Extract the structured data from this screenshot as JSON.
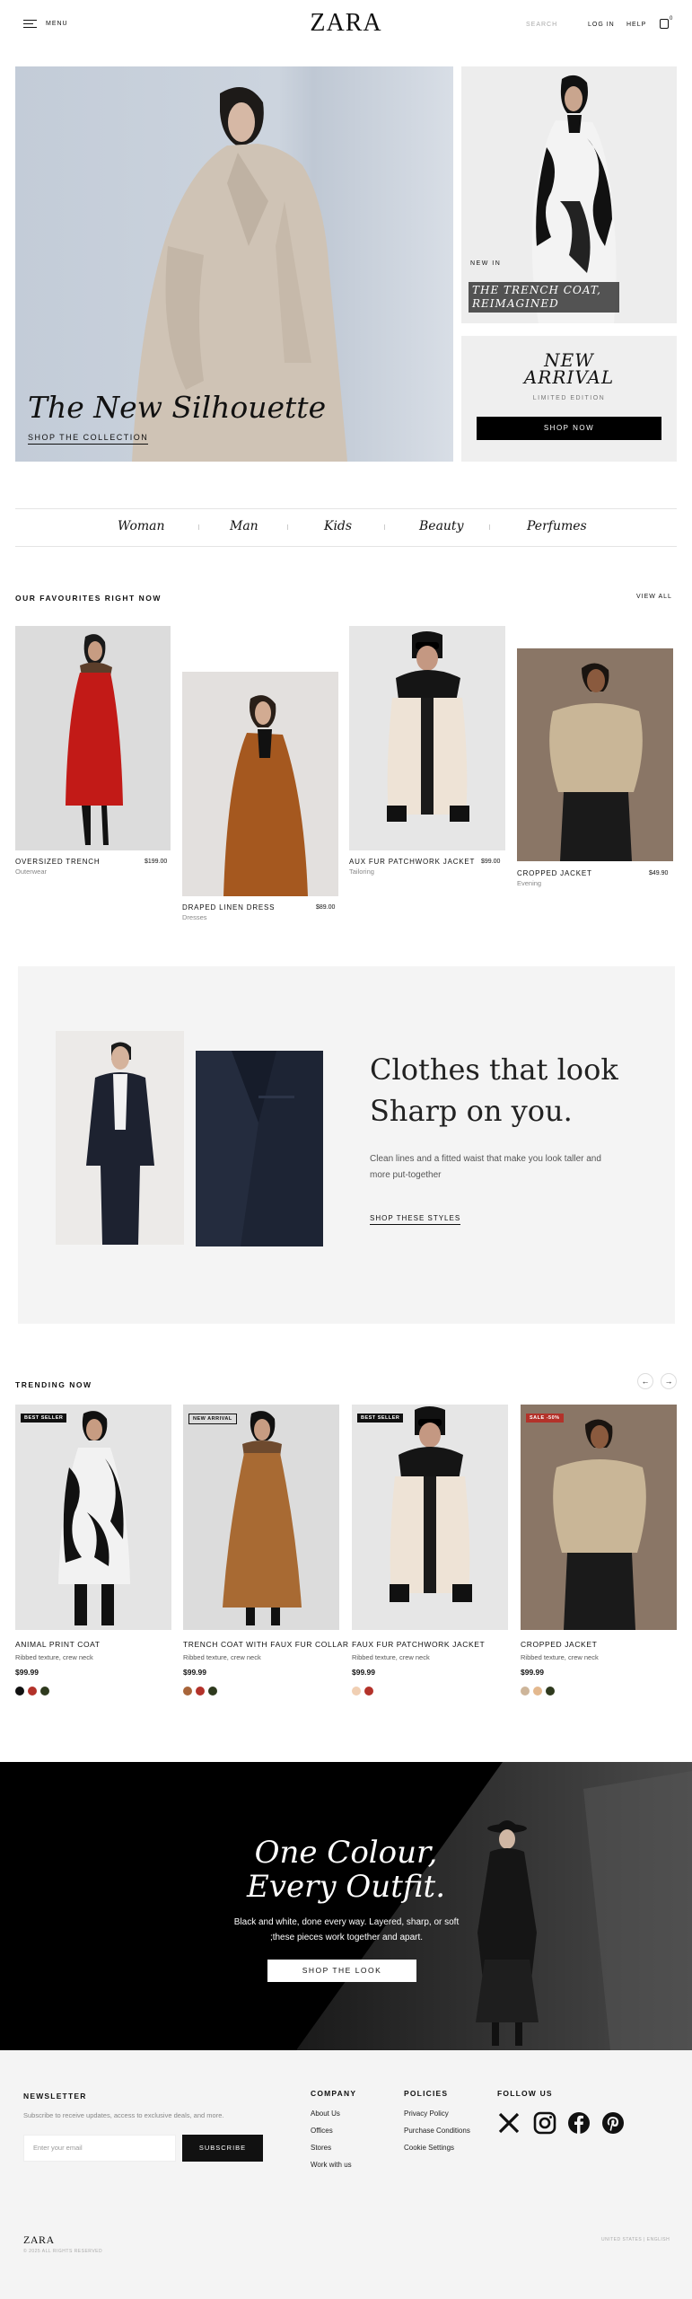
{
  "header": {
    "menu_label": "MENU",
    "logo": "ZARA",
    "search_placeholder": "SEARCH",
    "login_label": "LOG IN",
    "help_label": "HELP",
    "bag_count": "0"
  },
  "hero": {
    "title": "The New Silhouette",
    "cta": "SHOP THE COLLECTION",
    "side_tag": "NEW IN",
    "side_title_line1": "THE TRENCH COAT,",
    "side_title_line2": "REIMAGINED",
    "arrival_line1": "NEW",
    "arrival_line2": "ARRIVAL",
    "arrival_sub": "LIMITED EDITION",
    "arrival_btn": "SHOP NOW"
  },
  "categories": [
    "Woman",
    "Man",
    "Kids",
    "Beauty",
    "Perfumes"
  ],
  "favourites": {
    "title": "OUR FAVOURITES RIGHT NOW",
    "view_all": "VIEW ALL",
    "items": [
      {
        "name": "OVERSIZED TRENCH",
        "category": "Outerwear",
        "price": "$199.00"
      },
      {
        "name": "DRAPED LINEN DRESS",
        "category": "Dresses",
        "price": "$89.00"
      },
      {
        "name": "AUX FUR PATCHWORK JACKET",
        "category": "Tailoring",
        "price": "$99.00"
      },
      {
        "name": "CROPPED JACKET",
        "category": "Evening",
        "price": "$49.90"
      }
    ]
  },
  "sharp": {
    "title_line1": "Clothes that look",
    "title_line2": "Sharp on you.",
    "description": "Clean lines and a fitted waist that make you look taller and more put-together",
    "cta": "SHOP THESE STYLES"
  },
  "trending": {
    "title": "TRENDING NOW",
    "prev_icon": "←",
    "next_icon": "→",
    "items": [
      {
        "badge": "BEST SELLER",
        "name": "ANIMAL PRINT COAT",
        "desc": "Ribbed texture, crew neck",
        "price": "$99.99",
        "swatches": [
          "#111111",
          "#b3322a",
          "#2f3a1e"
        ]
      },
      {
        "badge": "NEW ARRIVAL",
        "name": "TRENCH COAT WITH FAUX FUR COLLAR",
        "desc": "Ribbed texture, crew neck",
        "price": "$99.99",
        "swatches": [
          "#a8653a",
          "#b3322a",
          "#2f3a1e"
        ]
      },
      {
        "badge": "BEST SELLER",
        "name": "FAUX FUR PATCHWORK JACKET",
        "desc": "Ribbed texture, crew neck",
        "price": "$99.99",
        "swatches": [
          "#f0cfb3",
          "#b3322a"
        ]
      },
      {
        "badge": "SALE -50%",
        "name": "CROPPED JACKET",
        "desc": "Ribbed texture, crew neck",
        "price": "$99.99",
        "swatches": [
          "#cdb59a",
          "#e3b88e",
          "#2f3a1e"
        ]
      }
    ]
  },
  "banner": {
    "title_line1": "One Colour,",
    "title_line2": "Every Outfit.",
    "description": "Black and white, done every way. Layered, sharp, or soft ;these pieces work together and apart.",
    "cta": "SHOP THE LOOK"
  },
  "footer": {
    "newsletter_title": "NEWSLETTER",
    "newsletter_sub": "Subscribe to receive updates, access to exclusive deals, and more.",
    "email_placeholder": "Enter your email",
    "subscribe_label": "SUBSCRIBE",
    "company_title": "COMPANY",
    "company_links": [
      "About Us",
      "Offices",
      "Stores",
      "Work with us"
    ],
    "policies_title": "POLICIES",
    "policies_links": [
      "Privacy Policy",
      "Purchase Conditions",
      "Cookie Settings"
    ],
    "follow_title": "FOLLOW US",
    "social_icons": [
      "x-icon",
      "instagram-icon",
      "facebook-icon",
      "pinterest-icon"
    ],
    "logo": "ZARA",
    "copyright": "© 2025 ALL RIGHTS RESERVED",
    "region": "UNITED STATES | ENGLISH"
  },
  "colors": {
    "accent": "#000000",
    "sale_badge": "#b3322a",
    "background": "#ffffff",
    "footer_bg": "#f4f4f4"
  }
}
